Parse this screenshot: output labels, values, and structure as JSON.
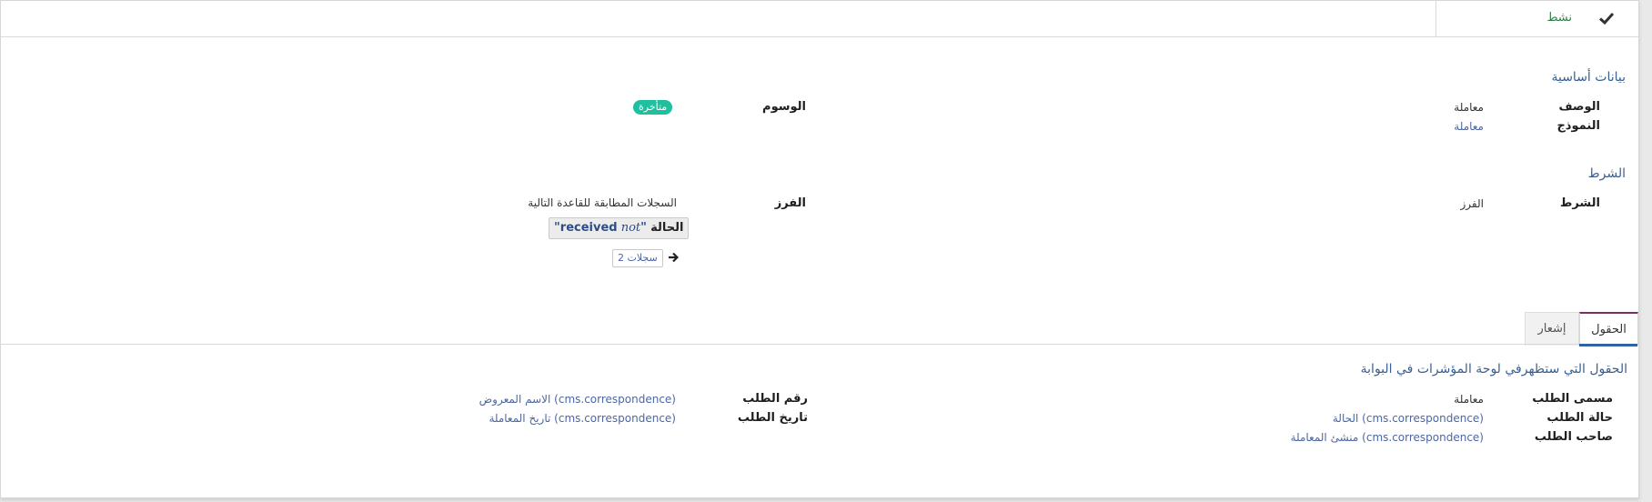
{
  "status_bar": {
    "active_label": "نشط"
  },
  "basic_section": {
    "title": "بيانات أساسية",
    "description_label": "الوصف",
    "description_value": "معاملة",
    "model_label": "النموذج",
    "model_value": "معاملة",
    "tags_label": "الوسوم",
    "tag": "متأخرة"
  },
  "condition_section": {
    "title": "الشرط",
    "condition_label": "الشرط",
    "condition_value": "الفرز",
    "filter_label": "الفرز",
    "matching_text": "السجلات المطابقة للقاعدة التالية",
    "domain": {
      "field": "الحالة",
      "operator": "not",
      "value": "received"
    },
    "records_button": "2 سجلات"
  },
  "tabs": {
    "fields": "الحقول",
    "notification": "إشعار"
  },
  "fields_section": {
    "title": "الحقول التي ستظهرفي لوحة المؤشرات في البوابة",
    "request_title_label": "مسمى الطلب",
    "request_title_value": "معاملة",
    "request_status_label": "حالة الطلب",
    "request_status_value": "الحالة (cms.correspondence)",
    "request_owner_label": "صاحب الطلب",
    "request_owner_value": "منشئ المعاملة (cms.correspondence)",
    "request_number_label": "رقم الطلب",
    "request_number_value": "الاسم المعروض (cms.correspondence)",
    "request_date_label": "تاريخ الطلب",
    "request_date_value": "تاريخ المعاملة (cms.correspondence)"
  }
}
